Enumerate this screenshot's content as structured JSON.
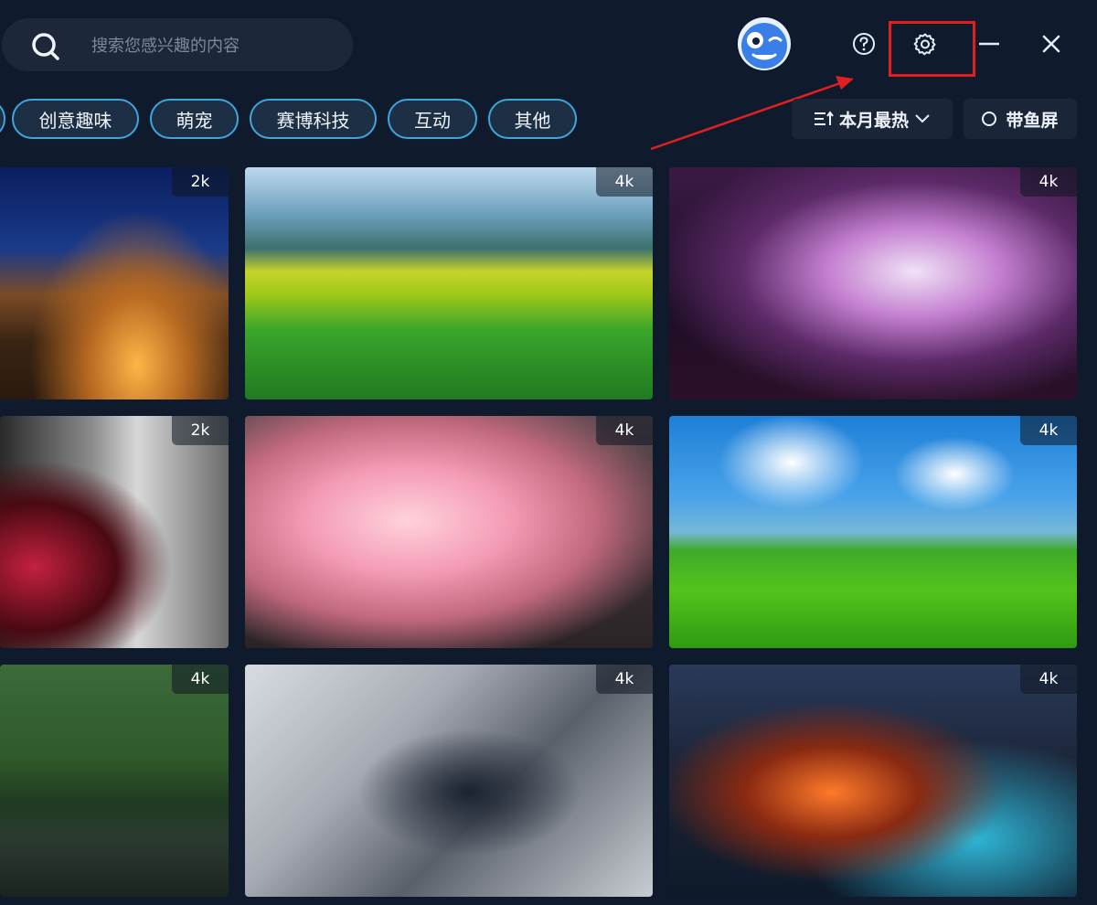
{
  "search": {
    "placeholder": "搜索您感兴趣的内容"
  },
  "header": {
    "avatar_icon": "mascot-avatar-icon",
    "help_icon": "help-icon",
    "settings_icon": "gear-icon",
    "minimize_icon": "minimize-icon",
    "close_icon": "close-icon"
  },
  "tags": [
    {
      "label": "创意趣味"
    },
    {
      "label": "萌宠"
    },
    {
      "label": "赛博科技"
    },
    {
      "label": "互动"
    },
    {
      "label": "其他"
    }
  ],
  "sort": {
    "label": "本月最热"
  },
  "fish_screen": {
    "label": "带鱼屏"
  },
  "wallpapers": [
    {
      "resolution": "2k"
    },
    {
      "resolution": "4k"
    },
    {
      "resolution": "4k"
    },
    {
      "resolution": "2k"
    },
    {
      "resolution": "4k"
    },
    {
      "resolution": "4k"
    },
    {
      "resolution": "4k"
    },
    {
      "resolution": "4k"
    },
    {
      "resolution": "4k"
    }
  ],
  "colors": {
    "background": "#0f1b2d",
    "tag_border": "#3fa6dc",
    "highlight": "#e02020"
  }
}
